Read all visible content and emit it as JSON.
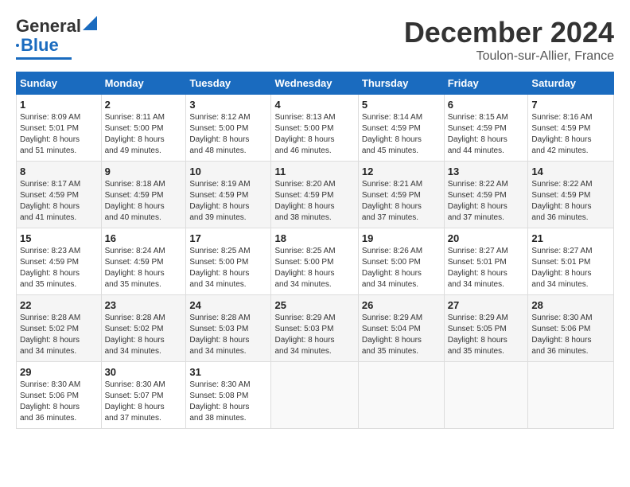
{
  "header": {
    "logo_general": "General",
    "logo_blue": "Blue",
    "title": "December 2024",
    "subtitle": "Toulon-sur-Allier, France"
  },
  "calendar": {
    "days_of_week": [
      "Sunday",
      "Monday",
      "Tuesday",
      "Wednesday",
      "Thursday",
      "Friday",
      "Saturday"
    ],
    "weeks": [
      [
        null,
        null,
        null,
        null,
        null,
        null,
        null
      ]
    ],
    "cells": [
      {
        "day": null,
        "info": ""
      },
      {
        "day": null,
        "info": ""
      },
      {
        "day": null,
        "info": ""
      },
      {
        "day": null,
        "info": ""
      },
      {
        "day": null,
        "info": ""
      },
      {
        "day": null,
        "info": ""
      },
      {
        "day": null,
        "info": ""
      },
      {
        "day": "1",
        "info": "Sunrise: 8:09 AM\nSunset: 5:01 PM\nDaylight: 8 hours\nand 51 minutes."
      },
      {
        "day": "2",
        "info": "Sunrise: 8:11 AM\nSunset: 5:00 PM\nDaylight: 8 hours\nand 49 minutes."
      },
      {
        "day": "3",
        "info": "Sunrise: 8:12 AM\nSunset: 5:00 PM\nDaylight: 8 hours\nand 48 minutes."
      },
      {
        "day": "4",
        "info": "Sunrise: 8:13 AM\nSunset: 5:00 PM\nDaylight: 8 hours\nand 46 minutes."
      },
      {
        "day": "5",
        "info": "Sunrise: 8:14 AM\nSunset: 4:59 PM\nDaylight: 8 hours\nand 45 minutes."
      },
      {
        "day": "6",
        "info": "Sunrise: 8:15 AM\nSunset: 4:59 PM\nDaylight: 8 hours\nand 44 minutes."
      },
      {
        "day": "7",
        "info": "Sunrise: 8:16 AM\nSunset: 4:59 PM\nDaylight: 8 hours\nand 42 minutes."
      },
      {
        "day": "8",
        "info": "Sunrise: 8:17 AM\nSunset: 4:59 PM\nDaylight: 8 hours\nand 41 minutes."
      },
      {
        "day": "9",
        "info": "Sunrise: 8:18 AM\nSunset: 4:59 PM\nDaylight: 8 hours\nand 40 minutes."
      },
      {
        "day": "10",
        "info": "Sunrise: 8:19 AM\nSunset: 4:59 PM\nDaylight: 8 hours\nand 39 minutes."
      },
      {
        "day": "11",
        "info": "Sunrise: 8:20 AM\nSunset: 4:59 PM\nDaylight: 8 hours\nand 38 minutes."
      },
      {
        "day": "12",
        "info": "Sunrise: 8:21 AM\nSunset: 4:59 PM\nDaylight: 8 hours\nand 37 minutes."
      },
      {
        "day": "13",
        "info": "Sunrise: 8:22 AM\nSunset: 4:59 PM\nDaylight: 8 hours\nand 37 minutes."
      },
      {
        "day": "14",
        "info": "Sunrise: 8:22 AM\nSunset: 4:59 PM\nDaylight: 8 hours\nand 36 minutes."
      },
      {
        "day": "15",
        "info": "Sunrise: 8:23 AM\nSunset: 4:59 PM\nDaylight: 8 hours\nand 35 minutes."
      },
      {
        "day": "16",
        "info": "Sunrise: 8:24 AM\nSunset: 4:59 PM\nDaylight: 8 hours\nand 35 minutes."
      },
      {
        "day": "17",
        "info": "Sunrise: 8:25 AM\nSunset: 5:00 PM\nDaylight: 8 hours\nand 34 minutes."
      },
      {
        "day": "18",
        "info": "Sunrise: 8:25 AM\nSunset: 5:00 PM\nDaylight: 8 hours\nand 34 minutes."
      },
      {
        "day": "19",
        "info": "Sunrise: 8:26 AM\nSunset: 5:00 PM\nDaylight: 8 hours\nand 34 minutes."
      },
      {
        "day": "20",
        "info": "Sunrise: 8:27 AM\nSunset: 5:01 PM\nDaylight: 8 hours\nand 34 minutes."
      },
      {
        "day": "21",
        "info": "Sunrise: 8:27 AM\nSunset: 5:01 PM\nDaylight: 8 hours\nand 34 minutes."
      },
      {
        "day": "22",
        "info": "Sunrise: 8:28 AM\nSunset: 5:02 PM\nDaylight: 8 hours\nand 34 minutes."
      },
      {
        "day": "23",
        "info": "Sunrise: 8:28 AM\nSunset: 5:02 PM\nDaylight: 8 hours\nand 34 minutes."
      },
      {
        "day": "24",
        "info": "Sunrise: 8:28 AM\nSunset: 5:03 PM\nDaylight: 8 hours\nand 34 minutes."
      },
      {
        "day": "25",
        "info": "Sunrise: 8:29 AM\nSunset: 5:03 PM\nDaylight: 8 hours\nand 34 minutes."
      },
      {
        "day": "26",
        "info": "Sunrise: 8:29 AM\nSunset: 5:04 PM\nDaylight: 8 hours\nand 35 minutes."
      },
      {
        "day": "27",
        "info": "Sunrise: 8:29 AM\nSunset: 5:05 PM\nDaylight: 8 hours\nand 35 minutes."
      },
      {
        "day": "28",
        "info": "Sunrise: 8:30 AM\nSunset: 5:06 PM\nDaylight: 8 hours\nand 36 minutes."
      },
      {
        "day": "29",
        "info": "Sunrise: 8:30 AM\nSunset: 5:06 PM\nDaylight: 8 hours\nand 36 minutes."
      },
      {
        "day": "30",
        "info": "Sunrise: 8:30 AM\nSunset: 5:07 PM\nDaylight: 8 hours\nand 37 minutes."
      },
      {
        "day": "31",
        "info": "Sunrise: 8:30 AM\nSunset: 5:08 PM\nDaylight: 8 hours\nand 38 minutes."
      },
      {
        "day": null,
        "info": ""
      },
      {
        "day": null,
        "info": ""
      },
      {
        "day": null,
        "info": ""
      },
      {
        "day": null,
        "info": ""
      }
    ]
  }
}
